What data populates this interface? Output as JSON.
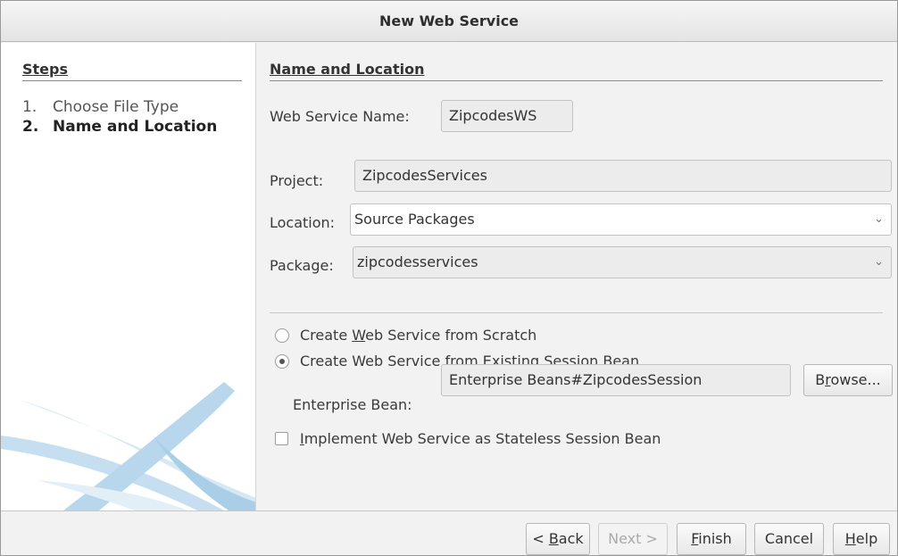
{
  "window": {
    "title": "New Web Service"
  },
  "steps": {
    "heading": "Steps",
    "items": [
      {
        "num": "1.",
        "label": "Choose File Type"
      },
      {
        "num": "2.",
        "label": "Name and Location"
      }
    ]
  },
  "main": {
    "heading": "Name and Location",
    "web_service_name_label": "Web Service Name:",
    "web_service_name_value": "ZipcodesWS",
    "project_label": "Project:",
    "project_value": "ZipcodesServices",
    "location_label": "Location:",
    "location_value": "Source Packages",
    "package_label": "Package:",
    "package_value": "zipcodesservices",
    "radio_scratch": {
      "pre": "Create ",
      "mnemonic": "W",
      "post": "eb Service from Scratch",
      "checked": false
    },
    "radio_existing": {
      "label": "Create Web Service from Existing Session Bean",
      "checked": true
    },
    "enterprise_bean_label": "Enterprise Bean:",
    "enterprise_bean_value": "Enterprise Beans#ZipcodesSession",
    "browse": {
      "pre": "B",
      "mnemonic": "r",
      "post": "owse..."
    },
    "stateless_checkbox": {
      "pre": "",
      "mnemonic": "I",
      "post": "mplement Web Service as Stateless Session Bean",
      "checked": false
    }
  },
  "footer": {
    "back": {
      "pre": "< ",
      "mnemonic": "B",
      "post": "ack"
    },
    "next": {
      "label": "Next >"
    },
    "finish": {
      "pre": "",
      "mnemonic": "F",
      "post": "inish"
    },
    "cancel": {
      "label": "Cancel"
    },
    "help": {
      "pre": "",
      "mnemonic": "H",
      "post": "elp"
    }
  }
}
